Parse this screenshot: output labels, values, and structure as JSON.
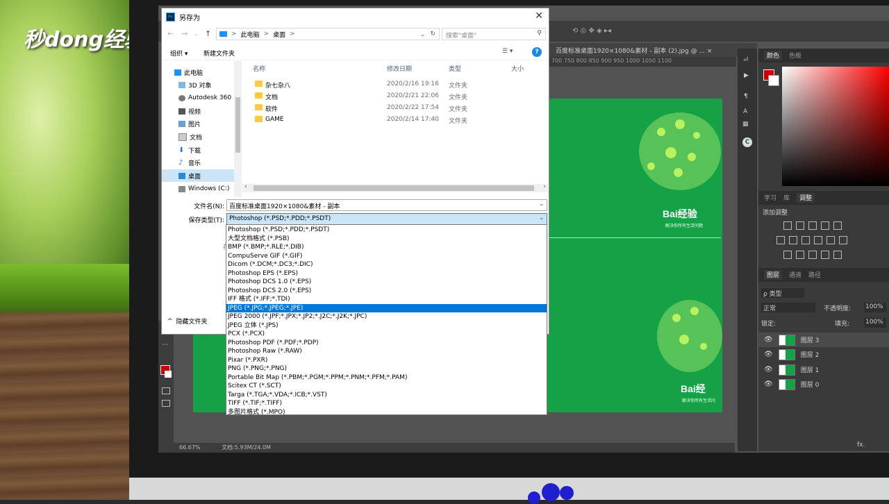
{
  "watermark": "秒dong经验",
  "dialog": {
    "title": "另存为",
    "address": {
      "pc": "此电脑",
      "sep": ">",
      "folder": "桌面",
      "sep2": ">"
    },
    "search_placeholder": "搜索\"桌面\"",
    "toolbar": {
      "organize": "组织 ▾",
      "new_folder": "新建文件夹",
      "help": "?"
    },
    "nav_items": [
      "此电脑",
      "3D 对象",
      "Autodesk 360",
      "视频",
      "图片",
      "文档",
      "下载",
      "音乐",
      "桌面",
      "Windows (C:)"
    ],
    "columns": {
      "name": "名称",
      "modified": "修改日期",
      "type": "类型",
      "size": "大小"
    },
    "files": [
      {
        "name": "杂七杂八",
        "date": "2020/2/16 19:16",
        "type": "文件夹"
      },
      {
        "name": "文档",
        "date": "2020/2/21 22:06",
        "type": "文件夹"
      },
      {
        "name": "软件",
        "date": "2020/2/22 17:54",
        "type": "文件夹"
      },
      {
        "name": "GAME",
        "date": "2020/2/14 17:40",
        "type": "文件夹"
      }
    ],
    "filename_label": "文件名(N):",
    "filename_value": "百度标准桌面1920×1080&素材 - 副本",
    "filetype_label": "保存类型(T):",
    "filetype_value": "Photoshop (*.PSD;*.PDD;*.PSDT)",
    "hidden_char": "存",
    "hide_folders": "隐藏文件夹",
    "hide_folders_icon": "^"
  },
  "dropdown_options": [
    "Photoshop (*.PSD;*.PDD;*.PSDT)",
    "大型文档格式 (*.PSB)",
    "BMP (*.BMP;*.RLE;*.DIB)",
    "CompuServe GIF (*.GIF)",
    "Dicom (*.DCM;*.DC3;*.DIC)",
    "Photoshop EPS (*.EPS)",
    "Photoshop DCS 1.0 (*.EPS)",
    "Photoshop DCS 2.0 (*.EPS)",
    "IFF 格式 (*.IFF;*.TDI)",
    "JPEG (*.JPG;*.JPEG;*.JPE)",
    "JPEG 2000 (*.JPF;*.JPX;*.JP2;*.J2C;*.J2K;*.JPC)",
    "JPEG 立体 (*.JPS)",
    "PCX (*.PCX)",
    "Photoshop PDF (*.PDF;*.PDP)",
    "Photoshop Raw (*.RAW)",
    "Pixar (*.PXR)",
    "PNG (*.PNG;*.PNG)",
    "Portable Bit Map (*.PBM;*.PGM;*.PPM;*.PNM;*.PFM;*.PAM)",
    "Scitex CT (*.SCT)",
    "Targa (*.TGA;*.VDA;*.ICB;*.VST)",
    "TIFF (*.TIF;*.TIFF)",
    "多图片格式 (*.MPO)"
  ],
  "dropdown_selected_index": 9,
  "photoshop": {
    "doc_tab": "百度标准桌面1920×1080&素材 - 副本 (2).jpg @ ...  ×",
    "ruler": "700   750   800   850   900   950   1000   1050   1100",
    "status_zoom": "66.67%",
    "status_doc": "文档:5.93M/24.0M",
    "panel_tabs_color": [
      "颜色",
      "色板"
    ],
    "panel_tabs_adjust": [
      "学习",
      "库",
      "调整"
    ],
    "adjust_title": "添加调整",
    "panel_tabs_layers": [
      "图层",
      "通道",
      "路径"
    ],
    "layer_kind": "ρ 类型",
    "blend_mode": "正常",
    "opacity_label": "不透明度:",
    "opacity_value": "100%",
    "lock_label": "锁定:",
    "fill_label": "填充:",
    "fill_value": "100%",
    "layers": [
      "图层 3",
      "图层 2",
      "图层 1",
      "图层 0"
    ],
    "selected_layer": 0,
    "canvas_brand": "Bai经验",
    "canvas_slogan": "解决你所有生活问题",
    "canvas_brand_2": "Bai经",
    "canvas_slogan_2": "解决你所有生活问",
    "fx_icon": "fx."
  },
  "colors": {
    "canvas_green": "#15a146",
    "selection_blue": "#0078d7",
    "accent_red": "#cc0000"
  }
}
